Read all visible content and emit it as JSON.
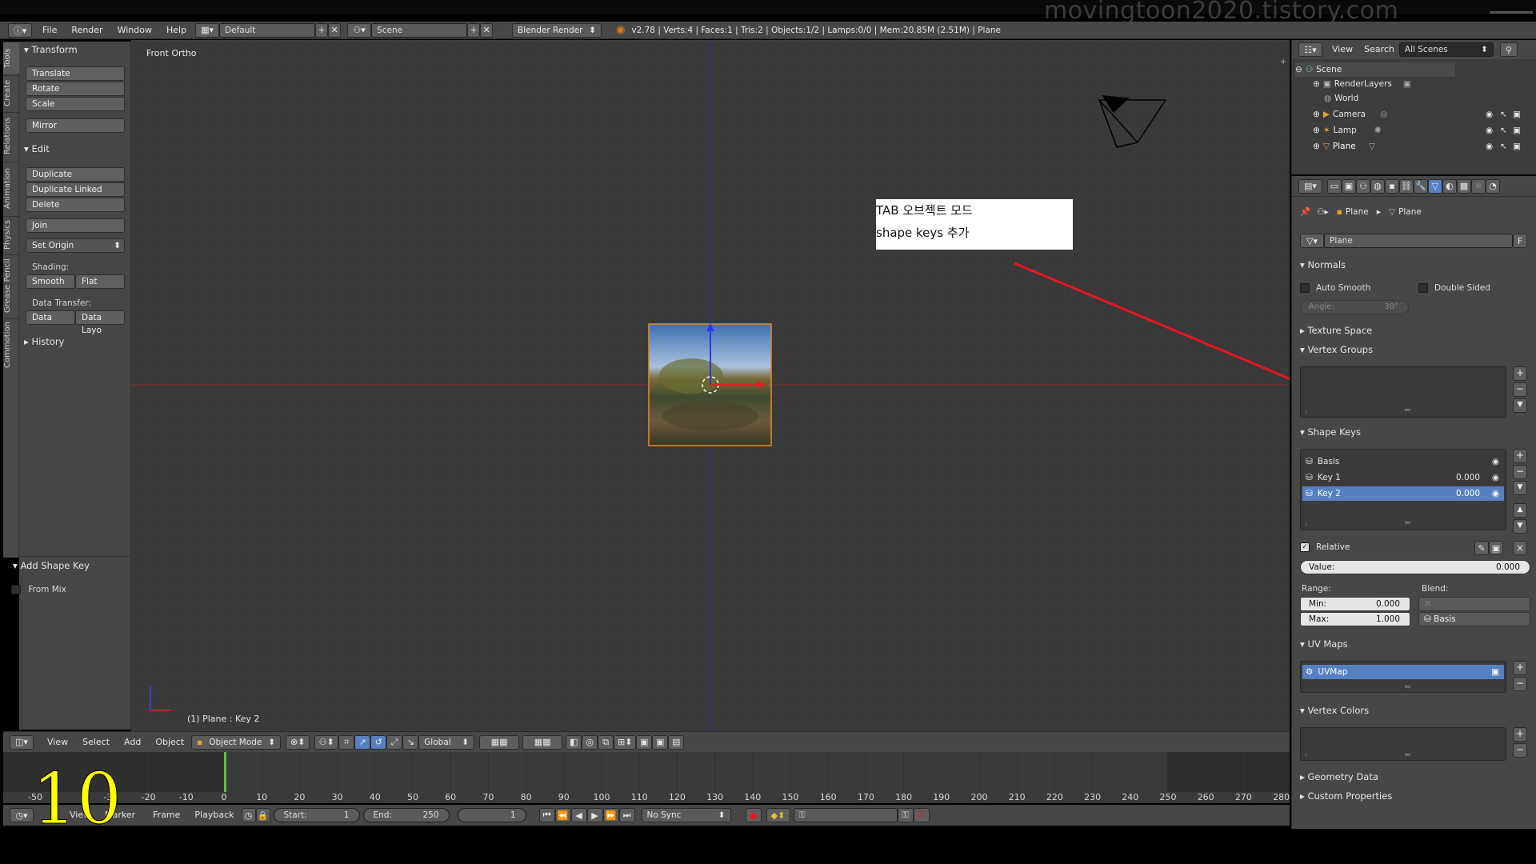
{
  "watermark": "movingtoon2020.tistory.com",
  "infobar": {
    "menus": [
      "File",
      "Render",
      "Window",
      "Help"
    ],
    "layout": "Default",
    "scene": "Scene",
    "engine": "Blender Render",
    "stats": "v2.78 | Verts:4 | Faces:1 | Tris:2 | Objects:1/2 | Lamps:0/0 | Mem:20.85M (2.51M) | Plane"
  },
  "tool_tabs": [
    "Tools",
    "Create",
    "Relations",
    "Animation",
    "Physics",
    "Grease Pencil",
    "Commotion"
  ],
  "toolshelf": {
    "transform_header": "Transform",
    "translate": "Translate",
    "rotate": "Rotate",
    "scale": "Scale",
    "mirror": "Mirror",
    "edit_header": "Edit",
    "duplicate": "Duplicate",
    "duplicate_linked": "Duplicate Linked",
    "delete": "Delete",
    "join": "Join",
    "set_origin": "Set Origin",
    "shading_label": "Shading:",
    "smooth": "Smooth",
    "flat": "Flat",
    "data_transfer_label": "Data Transfer:",
    "data": "Data",
    "data_layo": "Data Layo",
    "history_header": "History",
    "add_shape_key_header": "Add Shape Key",
    "from_mix": "From Mix"
  },
  "viewport": {
    "view_label": "Front Ortho",
    "object_label": "(1) Plane : Key 2",
    "annotation_line1": "TAB 오브젝트 모드",
    "annotation_line2": "shape keys 추가",
    "arrow_color": "#e8171f"
  },
  "viewport_header": {
    "menus": [
      "View",
      "Select",
      "Add",
      "Object"
    ],
    "mode": "Object Mode",
    "orientation": "Global"
  },
  "timeline": {
    "ruler": [
      "-50",
      "-30",
      "-20",
      "-10",
      "0",
      "10",
      "20",
      "30",
      "40",
      "50",
      "60",
      "70",
      "80",
      "90",
      "100",
      "110",
      "120",
      "130",
      "140",
      "150",
      "160",
      "170",
      "180",
      "190",
      "200",
      "210",
      "220",
      "230",
      "240",
      "250",
      "260",
      "270",
      "280"
    ],
    "current_frame_marker": "0",
    "end_range_shade": "250",
    "header_menus": [
      "View",
      "Marker",
      "Frame",
      "Playback"
    ],
    "start_label": "Start:",
    "start_value": "1",
    "end_label": "End:",
    "end_value": "250",
    "current_frame": "1",
    "sync": "No Sync"
  },
  "step_number": "10",
  "outliner": {
    "menus": [
      "View",
      "Search"
    ],
    "filter": "All Scenes",
    "items": [
      {
        "label": "Scene",
        "icon": "scene-icon"
      },
      {
        "label": "RenderLayers",
        "icon": "renderlayers-icon"
      },
      {
        "label": "World",
        "icon": "world-icon"
      },
      {
        "label": "Camera",
        "icon": "camera-icon"
      },
      {
        "label": "Lamp",
        "icon": "lamp-icon"
      },
      {
        "label": "Plane",
        "icon": "mesh-icon"
      }
    ]
  },
  "properties": {
    "breadcrumb_object": "Plane",
    "breadcrumb_data": "Plane",
    "datablock_name": "Plane",
    "datablock_fake": "F",
    "normals_header": "Normals",
    "auto_smooth": "Auto Smooth",
    "double_sided": "Double Sided",
    "angle_label": "Angle:",
    "angle_value": "30°",
    "texture_space_header": "Texture Space",
    "vertex_groups_header": "Vertex Groups",
    "shape_keys_header": "Shape Keys",
    "shape_keys": [
      {
        "name": "Basis",
        "value": ""
      },
      {
        "name": "Key 1",
        "value": "0.000"
      },
      {
        "name": "Key 2",
        "value": "0.000"
      }
    ],
    "relative": "Relative",
    "value_label": "Value:",
    "value_value": "0.000",
    "range_label": "Range:",
    "blend_label": "Blend:",
    "min_label": "Min:",
    "min_value": "0.000",
    "max_label": "Max:",
    "max_value": "1.000",
    "blend_basis": "Basis",
    "uv_maps_header": "UV Maps",
    "uv_map": "UVMap",
    "vertex_colors_header": "Vertex Colors",
    "geometry_data_header": "Geometry Data",
    "custom_properties_header": "Custom Properties"
  },
  "colors": {
    "selected_row": "#5680c2",
    "accent_red": "#e8171f",
    "frame_marker": "#60c040"
  }
}
